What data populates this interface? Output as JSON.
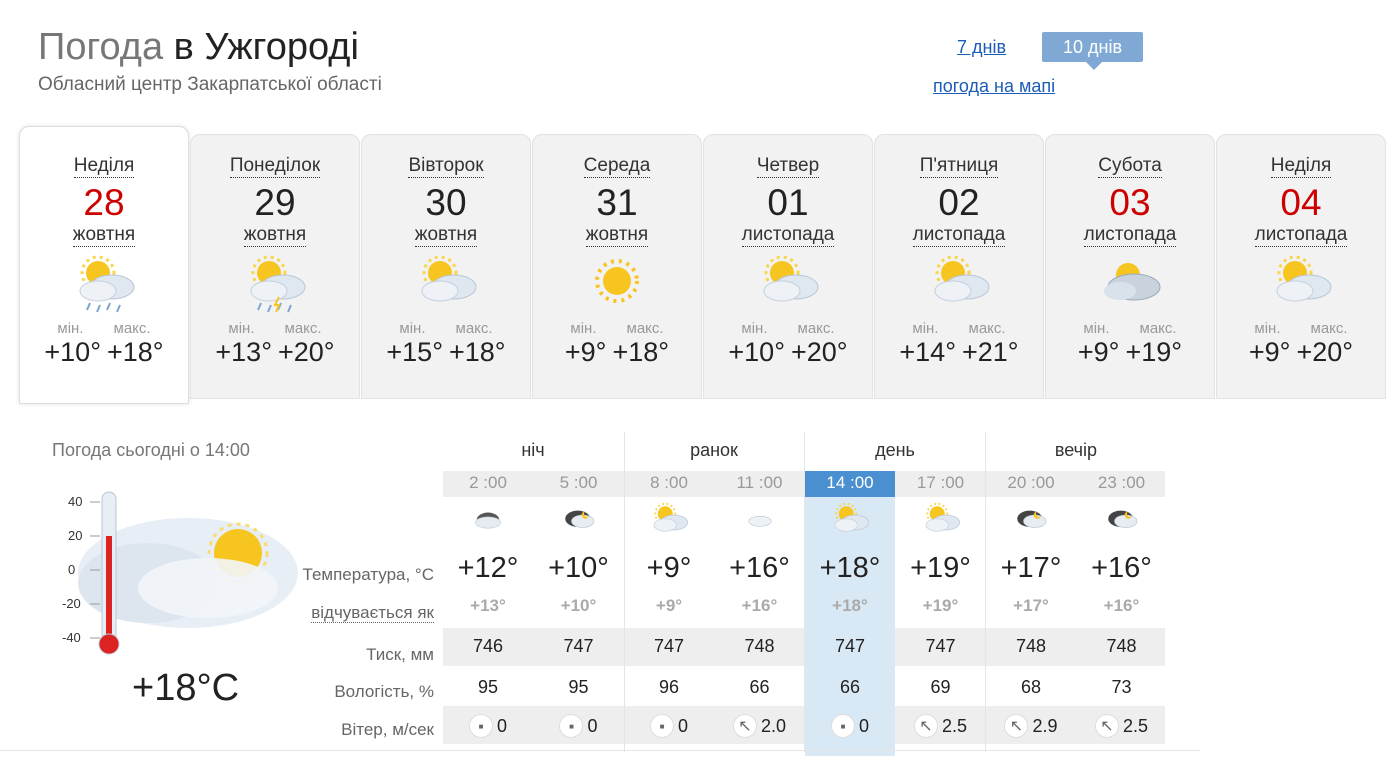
{
  "header": {
    "title_prefix": "Погода",
    "title_city": "в Ужгороді",
    "subtitle": "Обласний центр Закарпатської області",
    "link_7days": "7 днів",
    "btn_10days": "10 днів",
    "map_link": "погода на мапі"
  },
  "days": [
    {
      "name": "Неділя",
      "date": "28",
      "month": "жовтня",
      "weekend": true,
      "icon": "partly-cloudy-light-rain-icon",
      "min_label": "мін.",
      "max_label": "макс.",
      "min": "+10°",
      "max": "+18°"
    },
    {
      "name": "Понеділок",
      "date": "29",
      "month": "жовтня",
      "weekend": false,
      "icon": "partly-cloudy-rain-icon",
      "min_label": "мін.",
      "max_label": "макс.",
      "min": "+13°",
      "max": "+20°"
    },
    {
      "name": "Вівторок",
      "date": "30",
      "month": "жовтня",
      "weekend": false,
      "icon": "partly-cloudy-icon",
      "min_label": "мін.",
      "max_label": "макс.",
      "min": "+15°",
      "max": "+18°"
    },
    {
      "name": "Середа",
      "date": "31",
      "month": "жовтня",
      "weekend": false,
      "icon": "sun-icon",
      "min_label": "мін.",
      "max_label": "макс.",
      "min": "+9°",
      "max": "+18°"
    },
    {
      "name": "Четвер",
      "date": "01",
      "month": "листопада",
      "weekend": false,
      "icon": "partly-cloudy-icon",
      "min_label": "мін.",
      "max_label": "макс.",
      "min": "+10°",
      "max": "+20°"
    },
    {
      "name": "П'ятниця",
      "date": "02",
      "month": "листопада",
      "weekend": false,
      "icon": "partly-cloudy-icon",
      "min_label": "мін.",
      "max_label": "макс.",
      "min": "+14°",
      "max": "+21°"
    },
    {
      "name": "Субота",
      "date": "03",
      "month": "листопада",
      "weekend": true,
      "icon": "cloudy-sun-icon",
      "min_label": "мін.",
      "max_label": "макс.",
      "min": "+9°",
      "max": "+19°"
    },
    {
      "name": "Неділя",
      "date": "04",
      "month": "листопада",
      "weekend": true,
      "icon": "partly-cloudy-icon",
      "min_label": "мін.",
      "max_label": "макс.",
      "min": "+9°",
      "max": "+20°"
    }
  ],
  "now": {
    "label": "Погода сьогодні о 14:00",
    "temp": "+18°C",
    "scale": [
      "40",
      "20",
      "0",
      "-20",
      "-40"
    ],
    "icon": "partly-cloudy-large-icon"
  },
  "labels": {
    "temp": "Температура, °C",
    "feels": "відчувається як",
    "pressure": "Тиск, мм",
    "humidity": "Вологість, %",
    "wind": "Вітер, м/сек"
  },
  "periods": [
    "ніч",
    "ранок",
    "день",
    "вечір"
  ],
  "hours": [
    {
      "time": "2 :00",
      "icon": "cloudy-night-icon",
      "temp": "+12°",
      "feels": "+13°",
      "pressure": "746",
      "humidity": "95",
      "wind": "0",
      "wind_dir": "calm"
    },
    {
      "time": "5 :00",
      "icon": "cloudy-night-moon-icon",
      "temp": "+10°",
      "feels": "+10°",
      "pressure": "747",
      "humidity": "95",
      "wind": "0",
      "wind_dir": "calm"
    },
    {
      "time": "8 :00",
      "icon": "partly-cloudy-icon",
      "temp": "+9°",
      "feels": "+9°",
      "pressure": "747",
      "humidity": "96",
      "wind": "0",
      "wind_dir": "calm"
    },
    {
      "time": "11 :00",
      "icon": "cloud-icon",
      "temp": "+16°",
      "feels": "+16°",
      "pressure": "748",
      "humidity": "66",
      "wind": "2.0",
      "wind_dir": "nw"
    },
    {
      "time": "14 :00",
      "icon": "partly-cloudy-icon",
      "temp": "+18°",
      "feels": "+18°",
      "pressure": "747",
      "humidity": "66",
      "wind": "0",
      "wind_dir": "calm",
      "selected": true
    },
    {
      "time": "17 :00",
      "icon": "partly-cloudy-icon",
      "temp": "+19°",
      "feels": "+19°",
      "pressure": "747",
      "humidity": "69",
      "wind": "2.5",
      "wind_dir": "nw"
    },
    {
      "time": "20 :00",
      "icon": "cloudy-night-moon-icon",
      "temp": "+17°",
      "feels": "+17°",
      "pressure": "748",
      "humidity": "68",
      "wind": "2.9",
      "wind_dir": "nw"
    },
    {
      "time": "23 :00",
      "icon": "cloudy-night-moon-icon",
      "temp": "+16°",
      "feels": "+16°",
      "pressure": "748",
      "humidity": "73",
      "wind": "2.5",
      "wind_dir": "nw"
    }
  ],
  "colors": {
    "accent": "#4a90d0",
    "tab_button": "#7fa9d4",
    "weekend": "#cc0000",
    "link": "#1a5cb8"
  }
}
